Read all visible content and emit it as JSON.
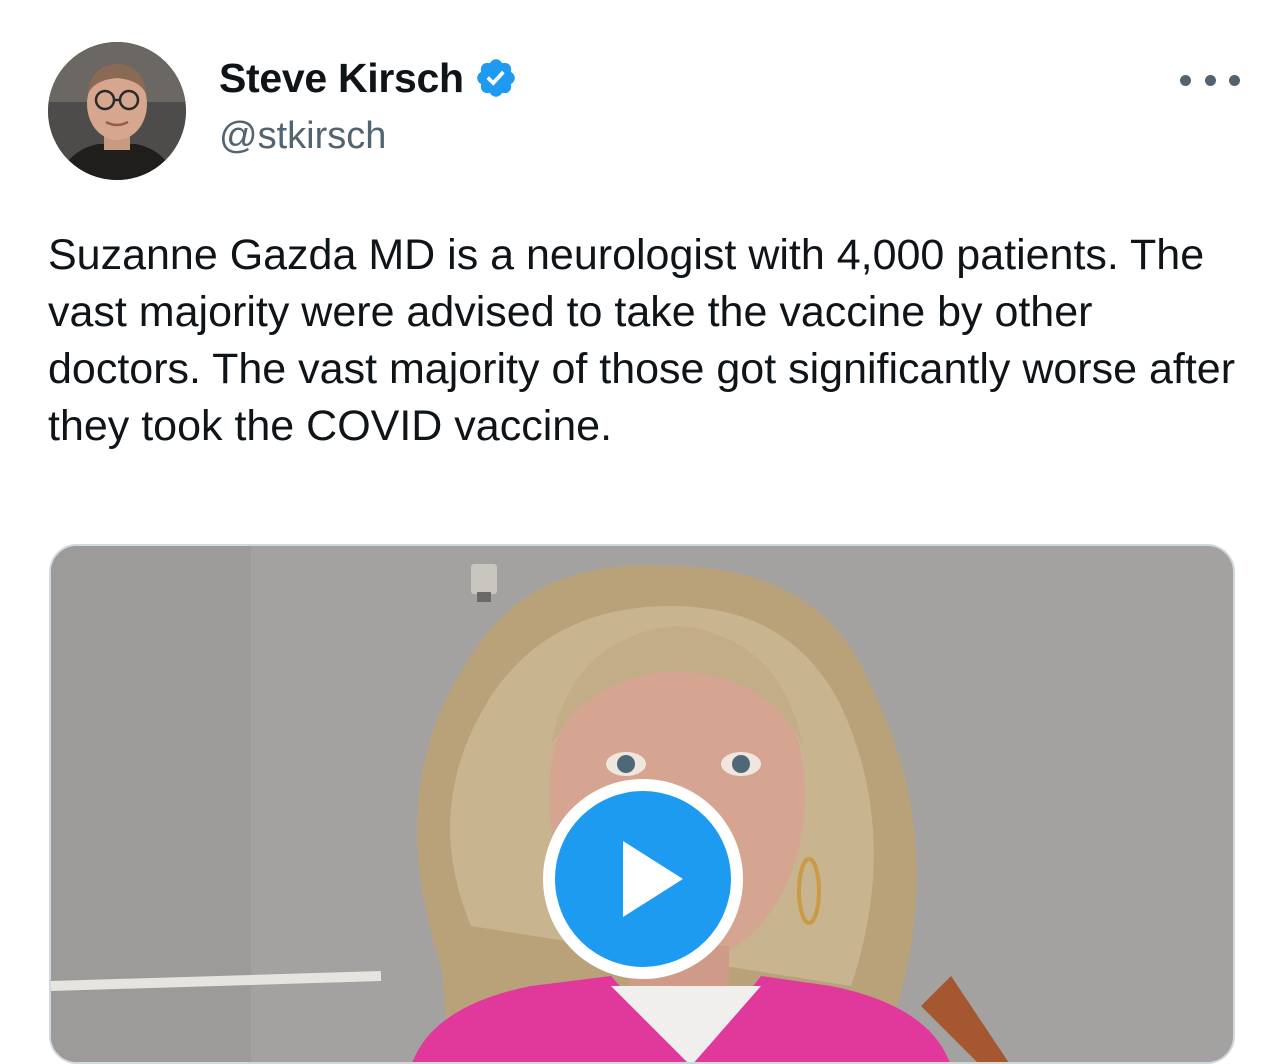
{
  "author": {
    "name": "Steve Kirsch",
    "handle": "@stkirsch",
    "verified": true
  },
  "tweet": {
    "text": "Suzanne Gazda MD is a neurologist with 4,000 patients. The vast majority were advised to take the vaccine by other doctors. The vast majority of those got significantly worse after they took the COVID vaccine."
  },
  "media": {
    "type": "video",
    "play_icon": "play-icon"
  },
  "icons": {
    "verified": "verified-badge-icon",
    "more": "more-options-icon"
  },
  "colors": {
    "accent": "#1d9bf0",
    "text_primary": "#0f1419",
    "text_secondary": "#536471",
    "border": "#cfd9de"
  }
}
